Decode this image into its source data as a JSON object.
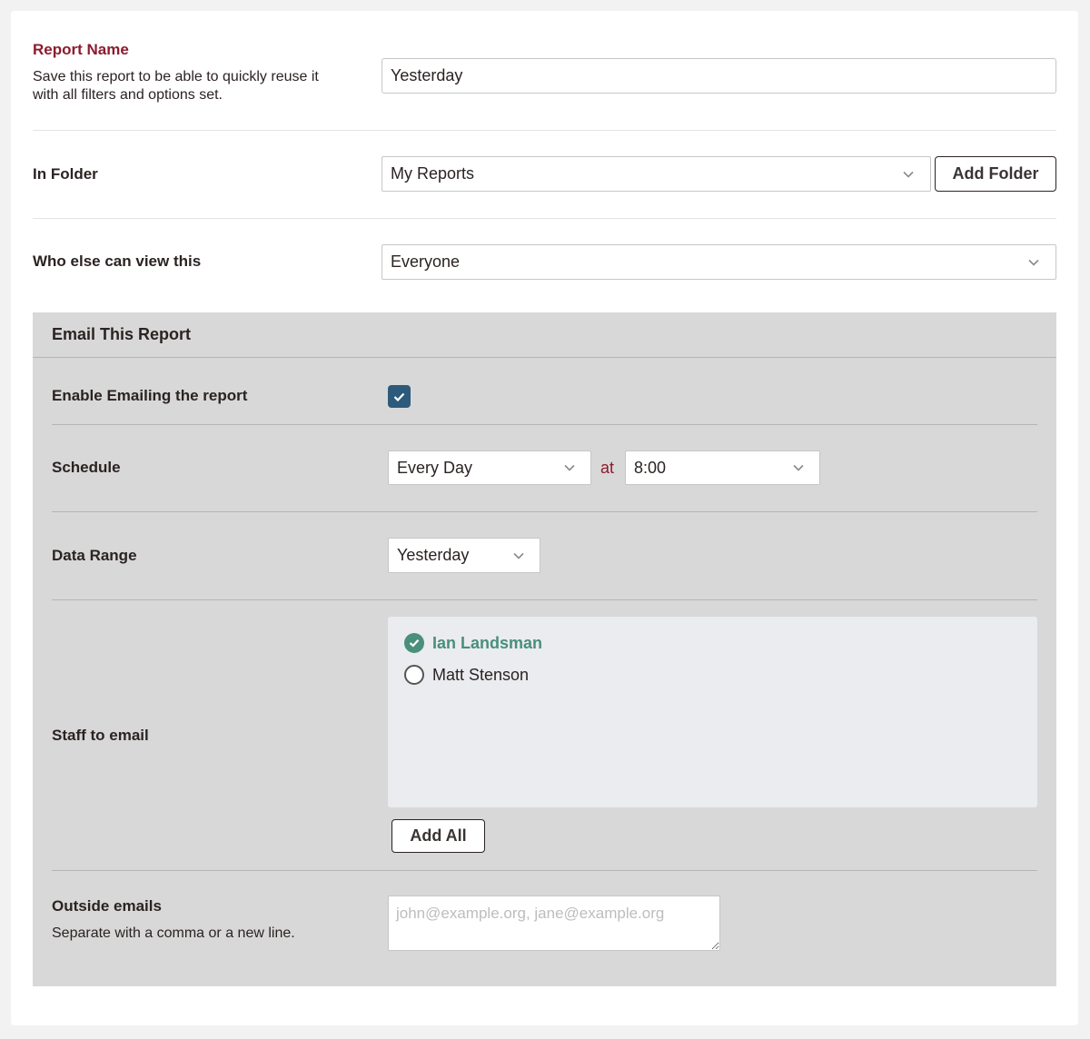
{
  "report_name": {
    "label": "Report Name",
    "description": "Save this report to be able to quickly reuse it with all filters and options set.",
    "value": "Yesterday"
  },
  "in_folder": {
    "label": "In Folder",
    "selected": "My Reports",
    "add_button": "Add Folder"
  },
  "visibility": {
    "label": "Who else can view this",
    "selected": "Everyone"
  },
  "email": {
    "title": "Email This Report",
    "enable_label": "Enable Emailing the report",
    "enabled": true,
    "schedule_label": "Schedule",
    "schedule_frequency": "Every Day",
    "schedule_at": "at",
    "schedule_time": "8:00",
    "data_range_label": "Data Range",
    "data_range": "Yesterday",
    "staff_label": "Staff to email",
    "staff": [
      {
        "name": "Ian Landsman",
        "selected": true
      },
      {
        "name": "Matt Stenson",
        "selected": false
      }
    ],
    "add_all_button": "Add All",
    "outside_label": "Outside emails",
    "outside_description": "Separate with a comma or a new line.",
    "outside_placeholder": "john@example.org, jane@example.org"
  },
  "colors": {
    "accent_red": "#8c1c2e",
    "checkbox_blue": "#2d5a7b",
    "selected_green": "#4a8f7a",
    "panel_gray": "#d8d8d8"
  }
}
